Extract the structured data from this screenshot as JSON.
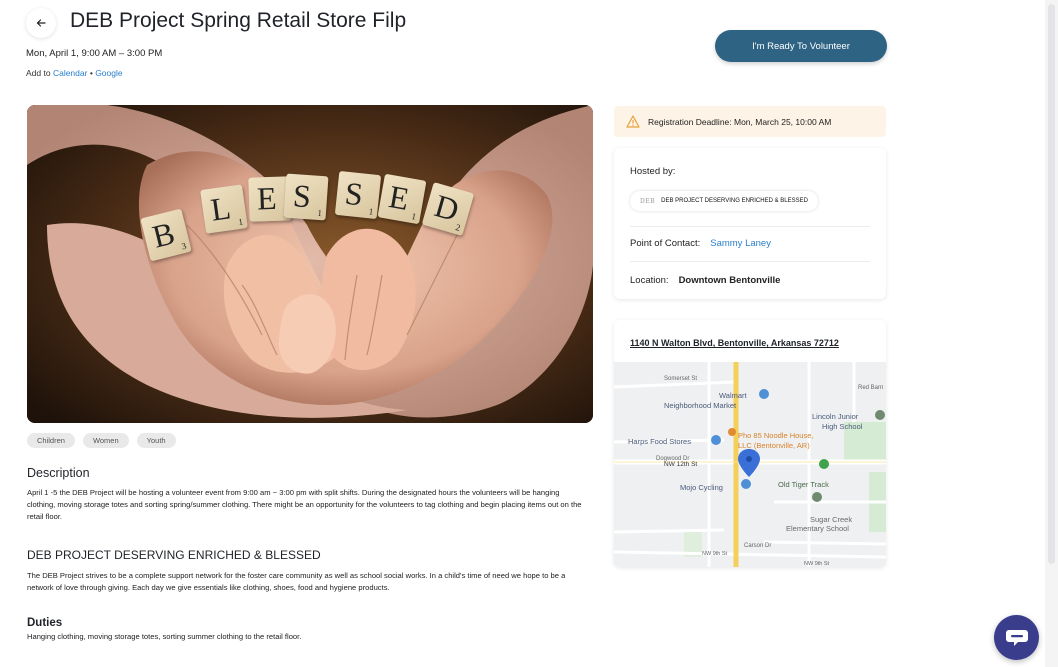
{
  "header": {
    "back_icon": "arrow-left-icon",
    "title": "DEB Project Spring Retail Store Filp",
    "date": "Mon, April 1, 9:00 AM – 3:00 PM",
    "add_to_prefix": "Add to",
    "calendar_link": "Calendar",
    "separator": "•",
    "google_link": "Google"
  },
  "volunteer_button": "I'm Ready To Volunteer",
  "hero_image": {
    "tiles": [
      {
        "letter": "B",
        "score": "3"
      },
      {
        "letter": "L",
        "score": "1"
      },
      {
        "letter": "E",
        "score": "1"
      },
      {
        "letter": "S",
        "score": "1"
      },
      {
        "letter": "S",
        "score": "1"
      },
      {
        "letter": "E",
        "score": "1"
      },
      {
        "letter": "D",
        "score": "2"
      }
    ]
  },
  "tags": [
    "Children",
    "Women",
    "Youth"
  ],
  "description": {
    "heading": "Description",
    "text": "April 1 -5 the DEB Project will be hosting a volunteer event from 9:00 am ~ 3:00 pm with split shifts.  During the designated hours the volunteers will be hanging clothing, moving storage totes and sorting spring/summer clothing.  There might be an opportunity for the volunteers to tag clothing and begin placing items out on the retail floor."
  },
  "organization": {
    "heading": "DEB PROJECT DESERVING ENRICHED & BLESSED",
    "text": "The DEB Project strives to be a complete support network for the foster care community as well as school social works.  In a child's time of need we hope to be a network of love through giving.  Each day we give essentials like clothing, shoes, food and hygiene products."
  },
  "duties": {
    "heading": "Duties",
    "text": "Hanging clothing, moving storage totes, sorting summer clothing to the retail floor."
  },
  "deadline": {
    "icon": "warning-icon",
    "text": "Registration Deadline: Mon, March 25, 10:00 AM"
  },
  "host": {
    "label": "Hosted by:",
    "org_logo_text": "DEB",
    "org_name": "DEB PROJECT DESERVING ENRICHED & BLESSED",
    "poc_label": "Point of Contact:",
    "poc_name": "Sammy Laney",
    "location_label": "Location:",
    "location_value": "Downtown Bentonville"
  },
  "map": {
    "address": "1140 N Walton Blvd, Bentonville, Arkansas 72712",
    "labels": {
      "somerset": "Somerset St",
      "red_barn": "Red Barn",
      "walmart_1": "Walmart",
      "walmart_2": "Neighborhood Market",
      "lincoln_1": "Lincoln Junior",
      "lincoln_2": "High School",
      "harps": "Harps Food Stores",
      "pho_1": "Pho 85 Noodle House,",
      "pho_2": "LLC (Bentonville, AR)",
      "nw12": "NW 12th St",
      "mojo": "Mojo Cycling",
      "oldtiger": "Old Tiger Track",
      "sugar_1": "Sugar Creek",
      "sugar_2": "Elementary School",
      "dogwood": "Dogwood Dr",
      "carson": "Carson Dr",
      "nw9": "NW 9th St",
      "nw9b": "NW 9th St"
    }
  },
  "chat_icon": "chat-bubble-icon",
  "colors": {
    "primary_button": "#2e6384",
    "link": "#2a7ec9",
    "deadline_bg": "#fdf3e6",
    "warning": "#e8a23a",
    "chat": "#3a3d8c",
    "map_pin": "#4285f4"
  }
}
